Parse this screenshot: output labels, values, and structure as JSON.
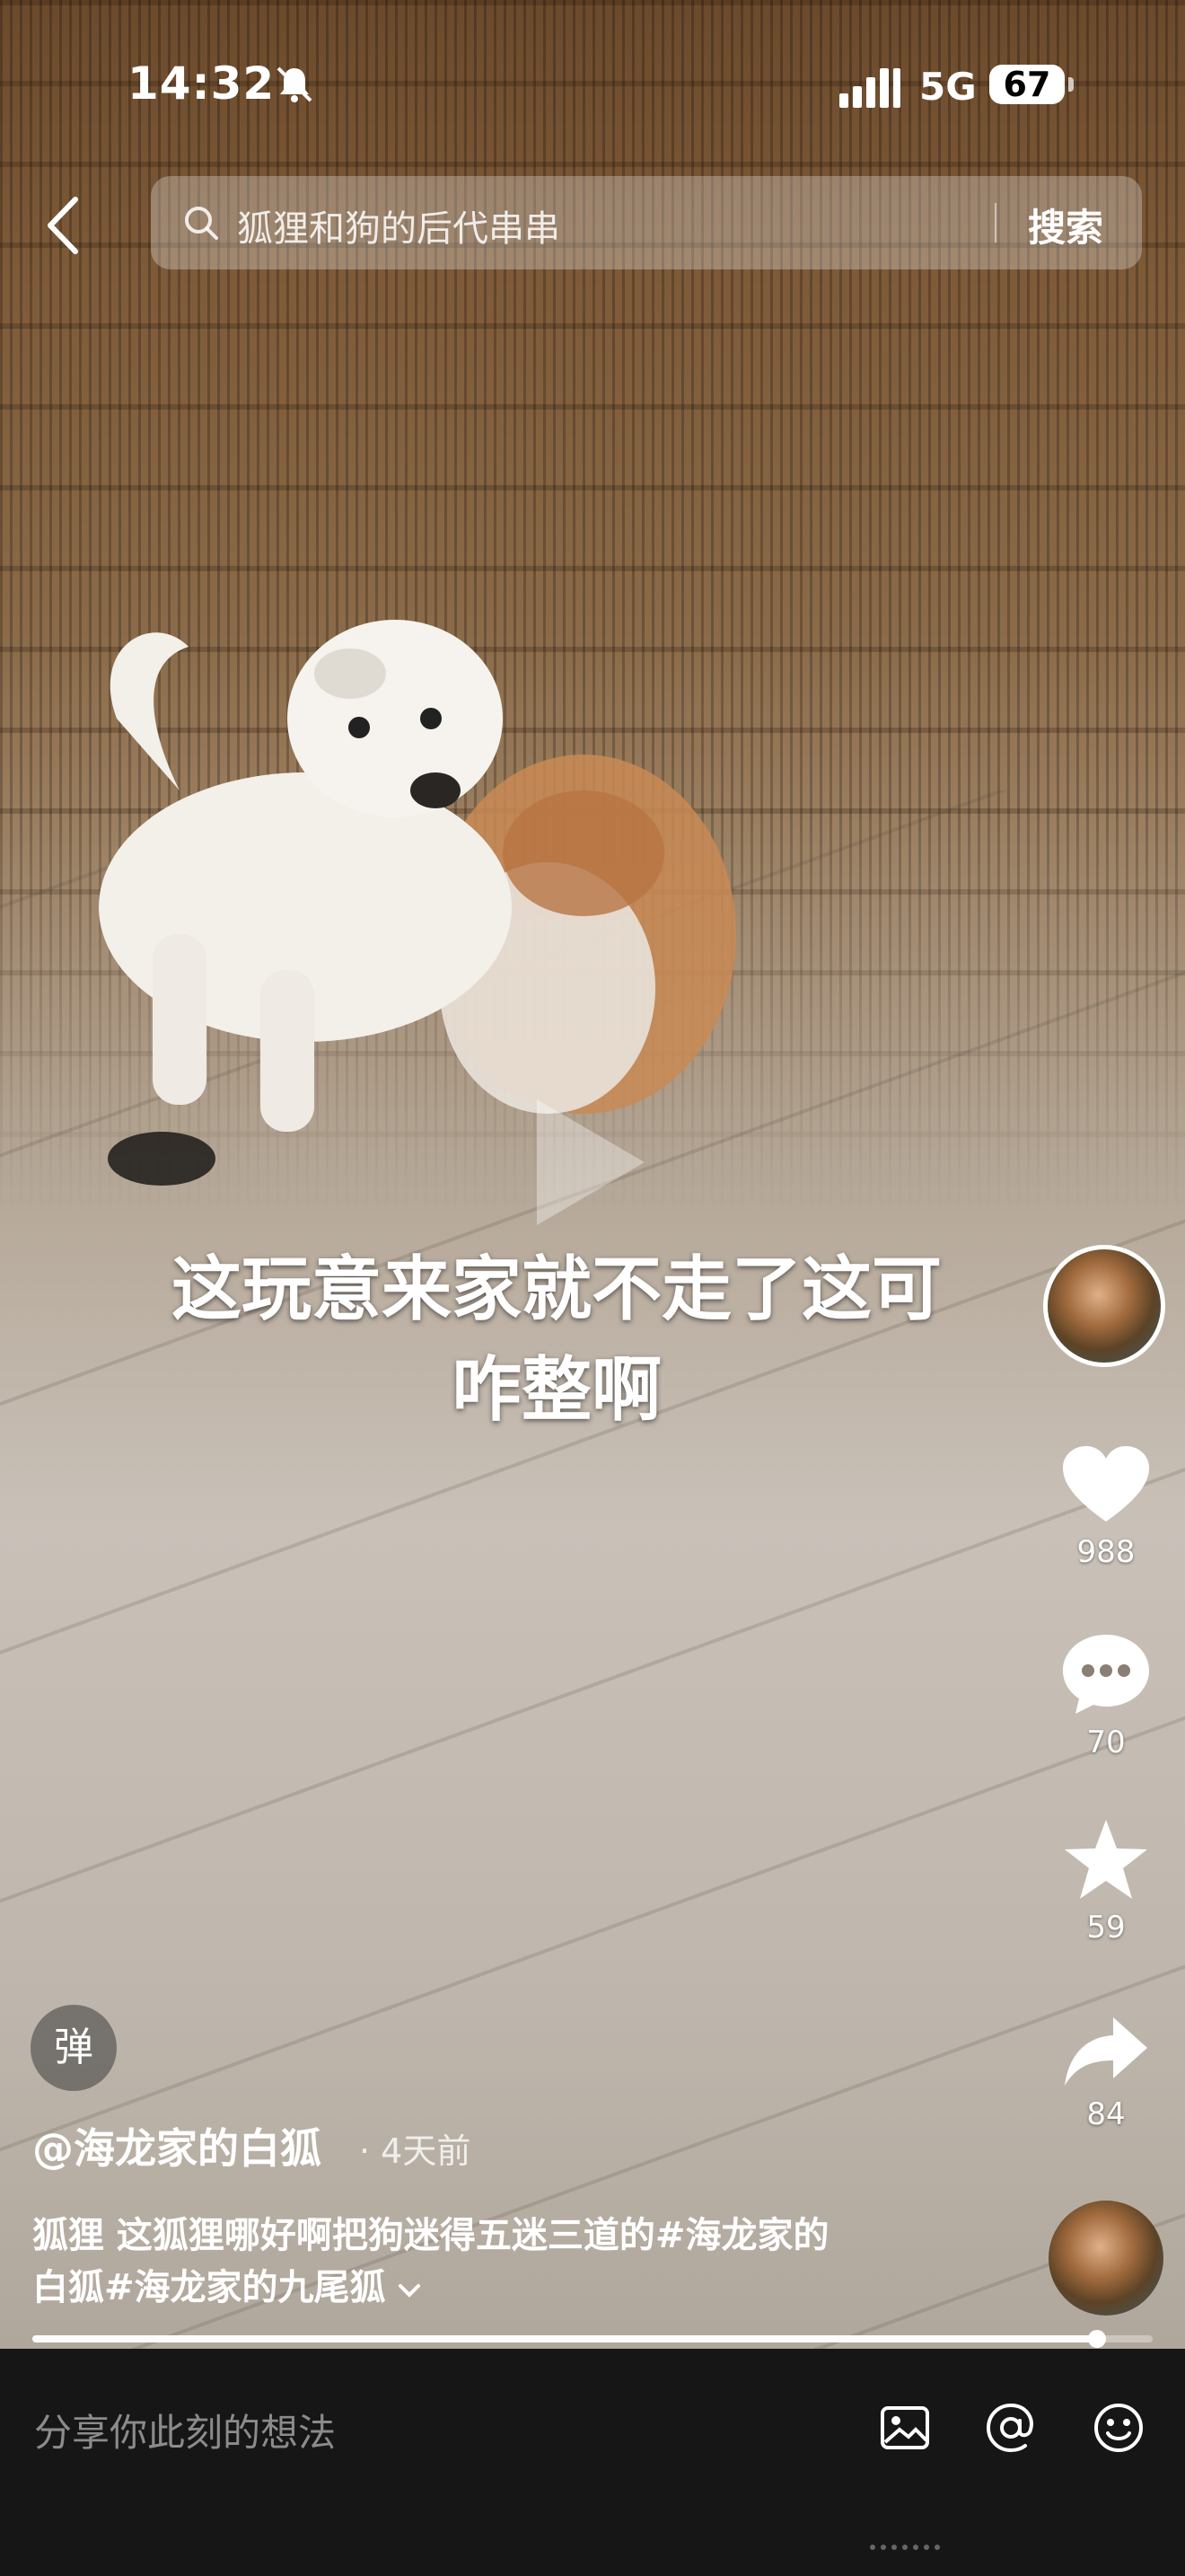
{
  "status_bar": {
    "time": "14:32",
    "network": "5G",
    "battery": "67"
  },
  "search": {
    "query": "狐狸和狗的后代串串",
    "button": "搜索"
  },
  "video": {
    "subtitle_line1": "这玩意来家就不走了这可",
    "subtitle_line2": "咋整啊",
    "progress": 0.95
  },
  "actions": {
    "likes": "988",
    "comments": "70",
    "favorites": "59",
    "shares": "84"
  },
  "danmu_label": "弹",
  "author": "@海龙家的白狐",
  "time_ago": "· 4天前",
  "description_line1": "狐狸 这狐狸哪好啊把狗迷得五迷三道的#海龙家的",
  "description_line2": "白狐#海龙家的九尾狐",
  "comment_placeholder": "分享你此刻的想法",
  "icons": [
    "chevron-left-icon",
    "search-icon",
    "bell-off-icon",
    "heart-icon",
    "comment-icon",
    "star-icon",
    "share-icon",
    "image-icon",
    "at-icon",
    "emoji-icon",
    "play-icon"
  ]
}
